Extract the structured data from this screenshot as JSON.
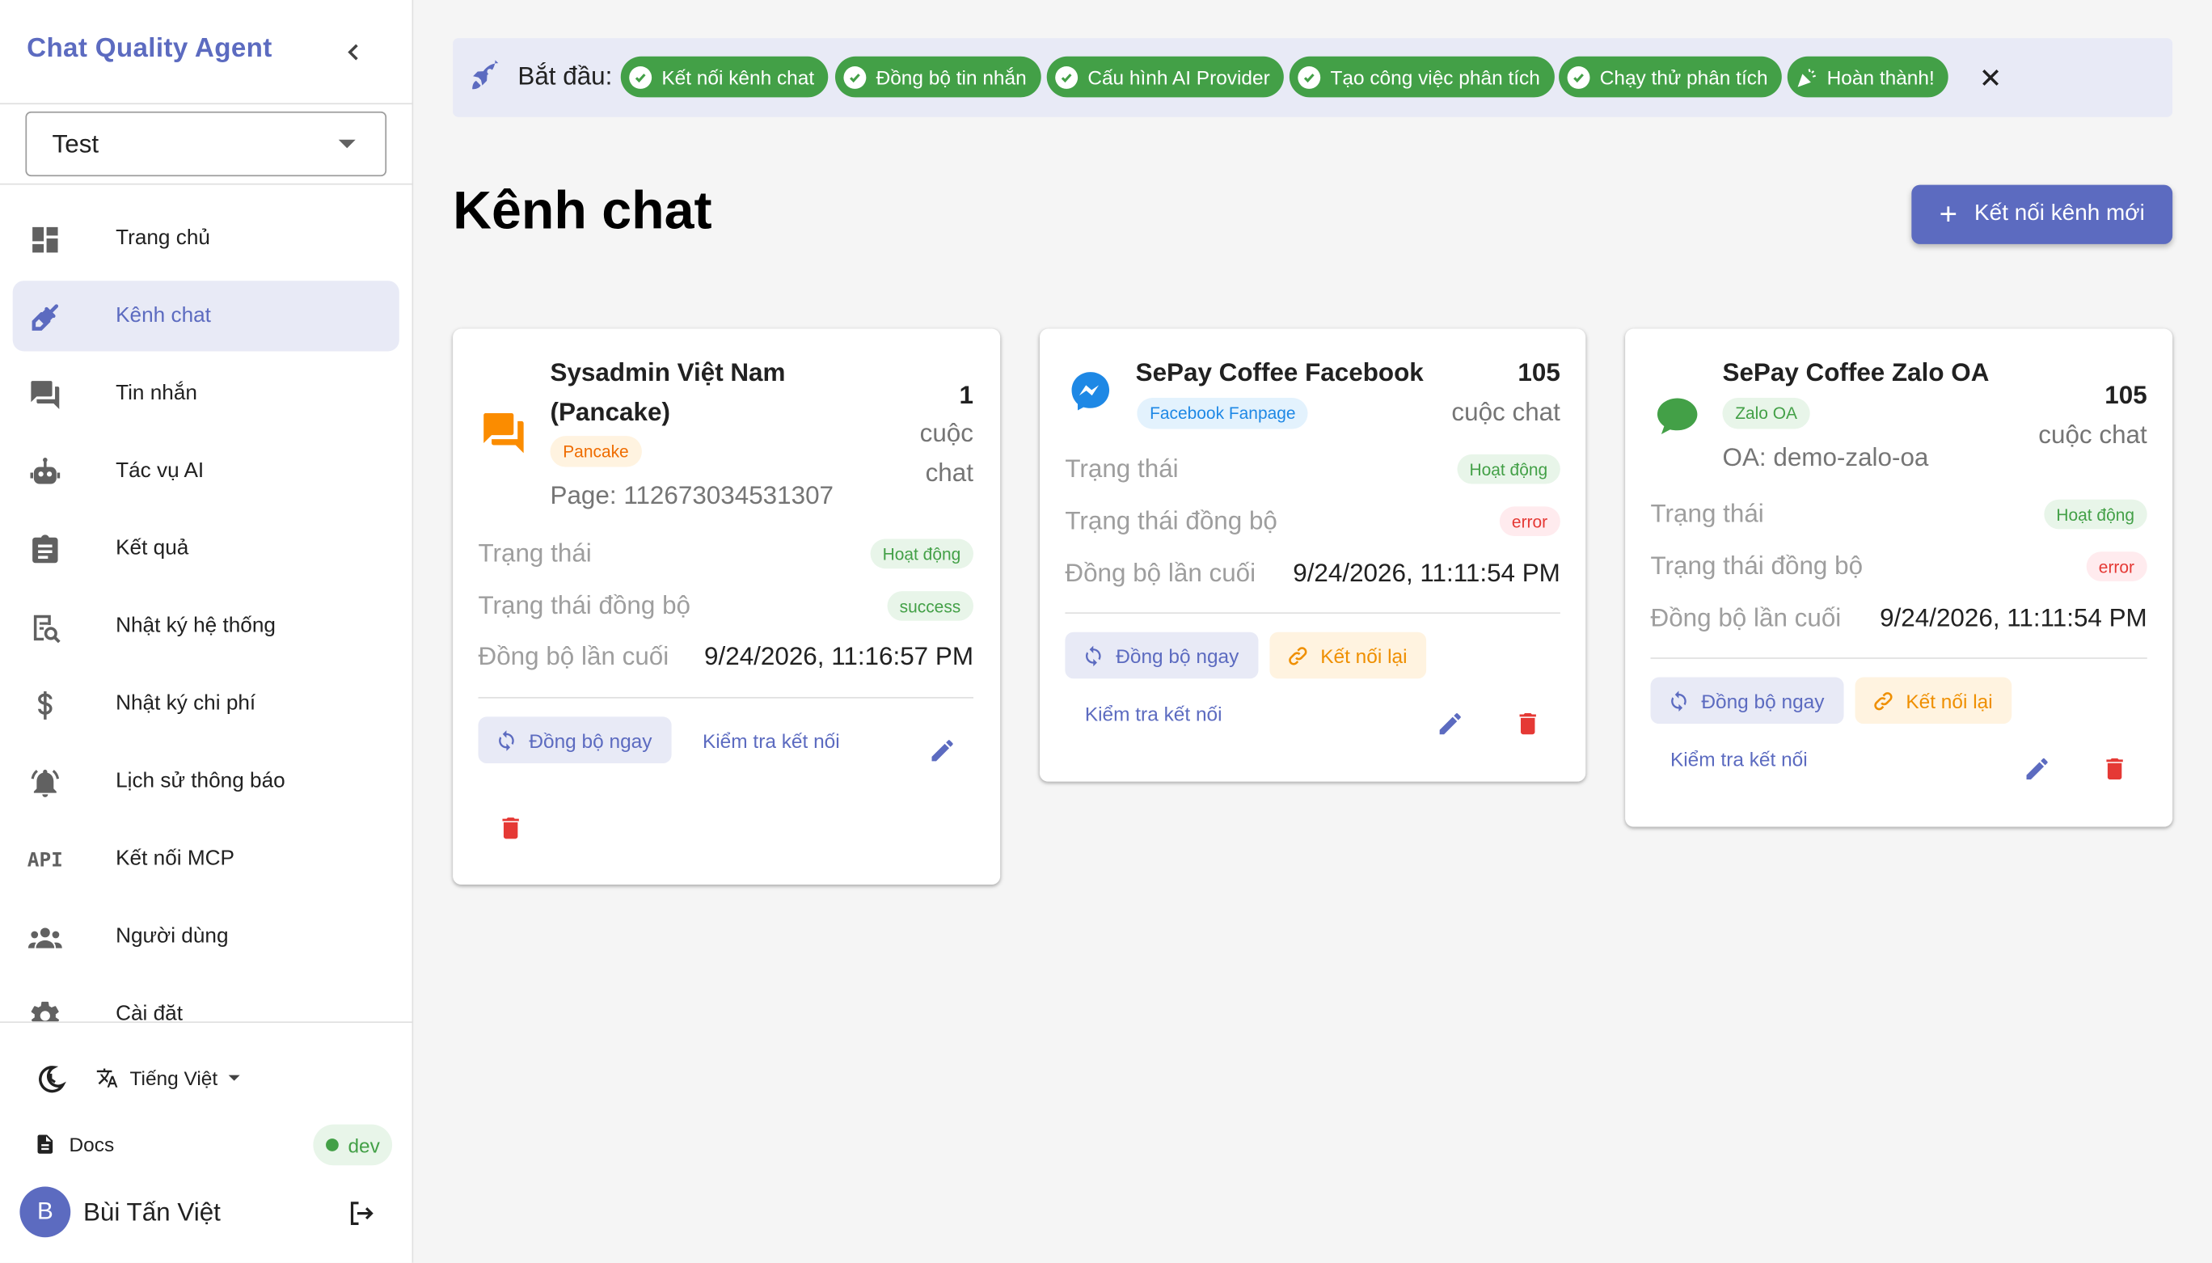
{
  "sidebar": {
    "app_title": "Chat Quality Agent",
    "workspace_select": "Test",
    "items": [
      {
        "label": "Trang chủ",
        "icon": "dashboard-icon"
      },
      {
        "label": "Kênh chat",
        "icon": "plug-icon",
        "active": true
      },
      {
        "label": "Tin nhắn",
        "icon": "forum-icon"
      },
      {
        "label": "Tác vụ AI",
        "icon": "robot-icon"
      },
      {
        "label": "Kết quả",
        "icon": "clipboard-icon"
      },
      {
        "label": "Nhật ký hệ thống",
        "icon": "search-log-icon"
      },
      {
        "label": "Nhật ký chi phí",
        "icon": "dollar-icon"
      },
      {
        "label": "Lịch sử thông báo",
        "icon": "bell-icon"
      },
      {
        "label": "Kết nối MCP",
        "icon": "api-icon"
      },
      {
        "label": "Người dùng",
        "icon": "users-icon"
      },
      {
        "label": "Cài đặt",
        "icon": "gear-icon"
      }
    ],
    "footer": {
      "language": "Tiếng Việt",
      "docs": "Docs",
      "env": "dev",
      "user_initial": "B",
      "user_name": "Bùi Tấn Việt"
    }
  },
  "onboarding": {
    "label": "Bắt đầu:",
    "steps": [
      "Kết nối kênh chat",
      "Đồng bộ tin nhắn",
      "Cấu hình AI Provider",
      "Tạo công việc phân tích",
      "Chạy thử phân tích",
      "Hoàn thành!"
    ]
  },
  "page": {
    "title": "Kênh chat",
    "new_button": "Kết nối kênh mới"
  },
  "labels": {
    "status": "Trạng thái",
    "sync_status": "Trạng thái đồng bộ",
    "last_sync": "Đồng bộ lần cuối",
    "sync_now": "Đồng bộ ngay",
    "reconnect": "Kết nối lại",
    "check_connection": "Kiểm tra kết nối",
    "chat_unit": "cuộc chat",
    "chat_unit_1": "cuộc",
    "chat_unit_2": "chat"
  },
  "channels": [
    {
      "name_line1": "Sysadmin Việt Nam",
      "name_line2": "(Pancake)",
      "type": "Pancake",
      "sub": "Page: 112673034531307",
      "count": "1",
      "status": "Hoạt động",
      "sync_status": "success",
      "last_sync": "9/24/2026, 11:16:57 PM",
      "icon": "chat-bubbles-icon",
      "colors": {
        "icon": "#fb8c00"
      }
    },
    {
      "name": "SePay Coffee Facebook",
      "type": "Facebook Fanpage",
      "count": "105",
      "status": "Hoạt động",
      "sync_status": "error",
      "last_sync": "9/24/2026, 11:11:54 PM",
      "icon": "messenger-icon",
      "colors": {
        "icon": "#1e88e5"
      }
    },
    {
      "name": "SePay Coffee Zalo OA",
      "type": "Zalo OA",
      "sub": "OA: demo-zalo-oa",
      "count": "105",
      "status": "Hoạt động",
      "sync_status": "error",
      "last_sync": "9/24/2026, 11:11:54 PM",
      "icon": "chat-bubble-icon",
      "colors": {
        "icon": "#43a047"
      }
    }
  ],
  "colors": {
    "primary": "#5c6bc0",
    "success": "#43a047",
    "error": "#e53935",
    "warning": "#ef8f00"
  }
}
